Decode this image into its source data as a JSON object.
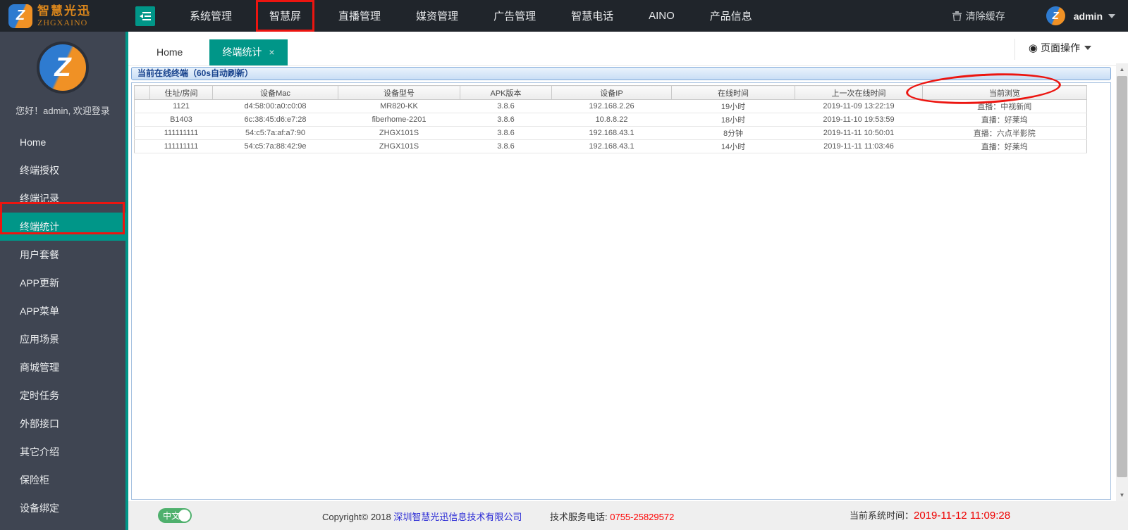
{
  "topbar": {
    "logo_title": "智慧光迅",
    "logo_subtitle": "ZHGXAINO",
    "logo_glyph": "Z",
    "nav": [
      {
        "label": "系统管理",
        "highlighted": false
      },
      {
        "label": "智慧屏",
        "highlighted": true
      },
      {
        "label": "直播管理",
        "highlighted": false
      },
      {
        "label": "媒资管理",
        "highlighted": false
      },
      {
        "label": "广告管理",
        "highlighted": false
      },
      {
        "label": "智慧电话",
        "highlighted": false
      },
      {
        "label": "AINO",
        "highlighted": false
      },
      {
        "label": "产品信息",
        "highlighted": false
      }
    ],
    "clear_cache_label": "清除缓存",
    "username": "admin"
  },
  "sidebar": {
    "welcome": "您好！admin, 欢迎登录",
    "items": [
      "Home",
      "终端授权",
      "终端记录",
      "终端统计",
      "用户套餐",
      "APP更新",
      "APP菜单",
      "应用场景",
      "商城管理",
      "定时任务",
      "外部接口",
      "其它介绍",
      "保险柜",
      "设备绑定"
    ],
    "active_item": "终端统计"
  },
  "tabs": {
    "items": [
      {
        "label": "Home",
        "active": false,
        "closable": false
      },
      {
        "label": "终端统计",
        "active": true,
        "closable": true
      }
    ],
    "close_icon": "×",
    "page_actions_label": "页面操作",
    "page_actions_icon": "◉"
  },
  "info_bar": "当前在线终端（60s自动刷新）",
  "table": {
    "headers": [
      "",
      "住址/房间",
      "设备Mac",
      "设备型号",
      "APK版本",
      "设备IP",
      "在线时间",
      "上一次在线时间",
      "当前浏览"
    ],
    "rows": [
      [
        "1121",
        "d4:58:00:a0:c0:08",
        "MR820-KK",
        "3.8.6",
        "192.168.2.26",
        "19小时",
        "2019-11-09 13:22:19",
        "直播：中视新闻"
      ],
      [
        "B1403",
        "6c:38:45:d6:e7:28",
        "fiberhome-2201",
        "3.8.6",
        "10.8.8.22",
        "18小时",
        "2019-11-10 19:53:59",
        "直播：好莱坞"
      ],
      [
        "111111111",
        "54:c5:7a:af:a7:90",
        "ZHGX101S",
        "3.8.6",
        "192.168.43.1",
        "8分钟",
        "2019-11-11 10:50:01",
        "直播：六点半影院"
      ],
      [
        "111111111",
        "54:c5:7a:88:42:9e",
        "ZHGX101S",
        "3.8.6",
        "192.168.43.1",
        "14小时",
        "2019-11-11 11:03:46",
        "直播：好莱坞"
      ]
    ]
  },
  "footer": {
    "language_toggle": "中文",
    "copyright_prefix": "Copyright© 2018 ",
    "company": "深圳智慧光迅信息技术有限公司",
    "phone_label": "技术服务电话: ",
    "phone": "0755-25829572",
    "time_label": "当前系统时间：",
    "time": "2019-11-12 11:09:28"
  },
  "colors": {
    "accent": "#009688",
    "topbar_bg": "#20252b",
    "sidebar_bg": "#3f4552",
    "annotation_red": "#ec1510",
    "link_blue": "#2b2bd5",
    "alert_red": "#ff0000"
  }
}
